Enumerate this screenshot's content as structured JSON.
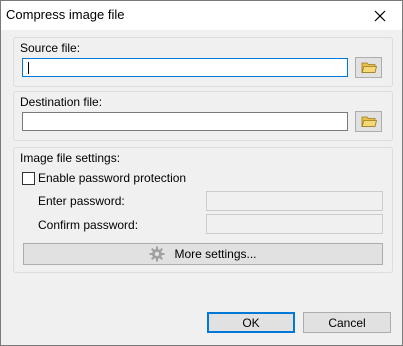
{
  "window": {
    "title": "Compress image file"
  },
  "source": {
    "label": "Source file:",
    "value": ""
  },
  "destination": {
    "label": "Destination file:",
    "value": ""
  },
  "image_settings": {
    "label": "Image file settings:",
    "enable_password_label": "Enable password protection",
    "enable_password_checked": false,
    "enter_password_label": "Enter password:",
    "confirm_password_label": "Confirm password:",
    "more_settings_label": "More settings..."
  },
  "buttons": {
    "ok_label": "OK",
    "cancel_label": "Cancel"
  },
  "icons": {
    "close": "close-icon",
    "folder": "folder-icon",
    "gear": "gear-icon"
  },
  "colors": {
    "dialog_bg": "#f0f0f0",
    "focus_accent": "#0078d7",
    "folder_yellow": "#e8c04a"
  }
}
